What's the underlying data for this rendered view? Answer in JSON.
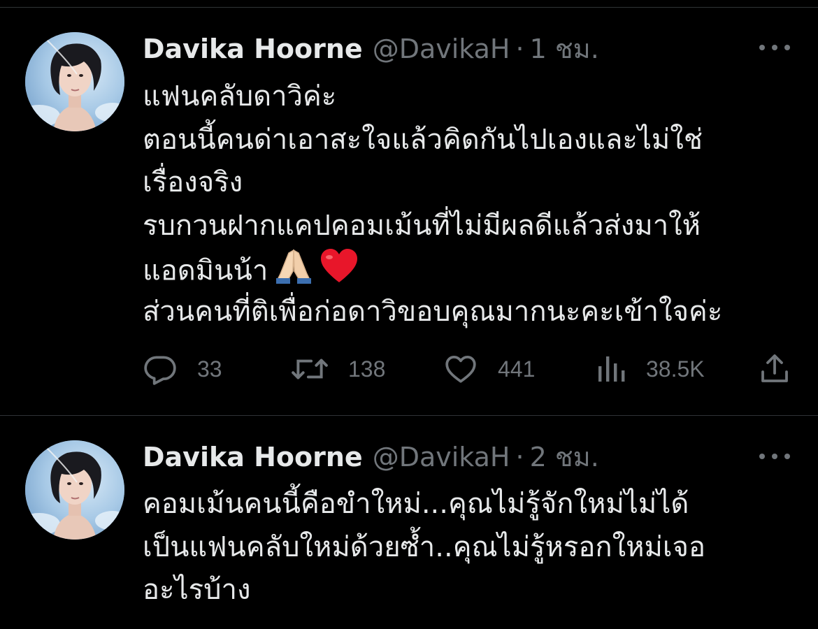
{
  "tweets": [
    {
      "author": {
        "name": "Davika Hoorne",
        "handle": "@DavikaH"
      },
      "separator": "·",
      "time": "1 ชม.",
      "text_lines": [
        "แฟนคลับดาวิค่ะ",
        "ตอนนี้คนด่าเอาสะใจแล้วคิดกันไปเองและไม่ใช่",
        "เรื่องจริง",
        "รบกวนฝากแคปคอมเม้นที่ไม่มีผลดีแล้วส่งมาให้",
        "แอดมินน้า",
        "ส่วนคนที่ติเพื่อก่อดาวิขอบคุณมากนะคะเข้าใจค่ะ"
      ],
      "emojis": [
        "folded-hands",
        "red-heart"
      ],
      "stats": {
        "replies": "33",
        "retweets": "138",
        "likes": "441",
        "views": "38.5K"
      }
    },
    {
      "author": {
        "name": "Davika Hoorne",
        "handle": "@DavikaH"
      },
      "separator": "·",
      "time": "2 ชม.",
      "text_lines": [
        "คอมเม้นคนนี้คือขำใหม่...คุณไม่รู้จักใหม่ไม่ได้",
        "เป็นแฟนคลับใหม่ด้วยซ้ำ..คุณไม่รู้หรอกใหม่เจอ",
        "อะไรบ้าง"
      ]
    }
  ],
  "icons": {
    "reply": "reply-icon",
    "retweet": "retweet-icon",
    "like": "heart-icon",
    "views": "views-icon",
    "share": "share-icon",
    "more": "more-icon"
  },
  "colors": {
    "background": "#000000",
    "text": "#e7e9ea",
    "secondary": "#71767b",
    "divider": "#2f3336"
  }
}
